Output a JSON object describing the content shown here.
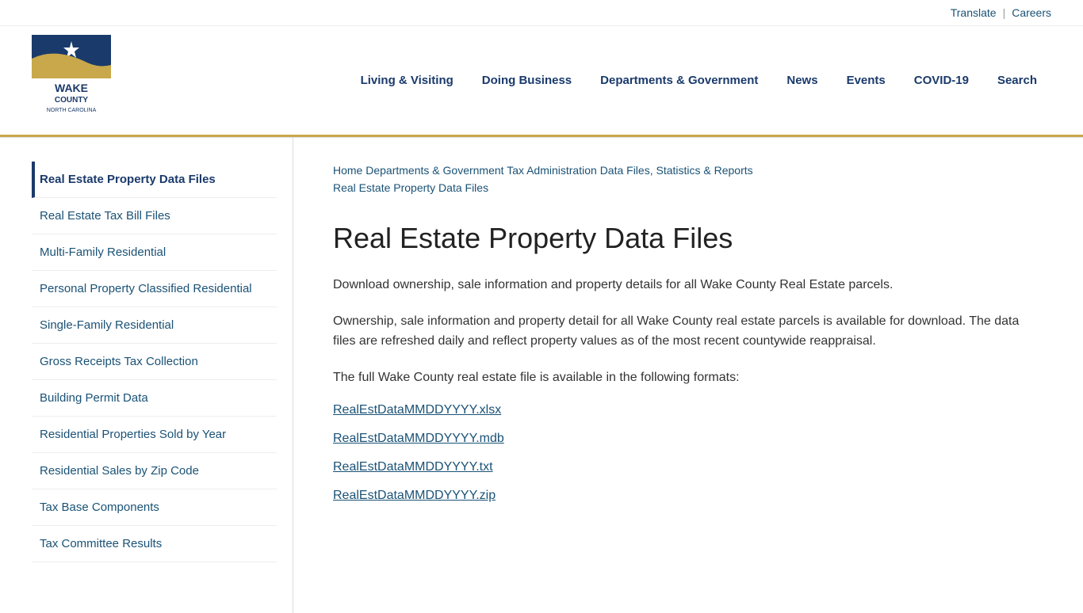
{
  "topbar": {
    "translate_label": "Translate",
    "separator": "|",
    "careers_label": "Careers"
  },
  "header": {
    "logo_alt": "Wake County North Carolina",
    "nav_items": [
      {
        "label": "Living & Visiting",
        "id": "living-visiting"
      },
      {
        "label": "Doing Business",
        "id": "doing-business"
      },
      {
        "label": "Departments & Government",
        "id": "departments-government"
      },
      {
        "label": "News",
        "id": "news"
      },
      {
        "label": "Events",
        "id": "events"
      },
      {
        "label": "COVID-19",
        "id": "covid-19"
      },
      {
        "label": "Search",
        "id": "search"
      }
    ]
  },
  "sidebar": {
    "items": [
      {
        "label": "Real Estate Property Data Files",
        "active": true,
        "id": "real-estate-data-files"
      },
      {
        "label": "Real Estate Tax Bill Files",
        "active": false,
        "id": "real-estate-tax-bill"
      },
      {
        "label": "Multi-Family Residential",
        "active": false,
        "id": "multi-family-residential"
      },
      {
        "label": "Personal Property Classified Residential",
        "active": false,
        "id": "personal-property-classified"
      },
      {
        "label": "Single-Family Residential",
        "active": false,
        "id": "single-family-residential"
      },
      {
        "label": "Gross Receipts Tax Collection",
        "active": false,
        "id": "gross-receipts-tax"
      },
      {
        "label": "Building Permit Data",
        "active": false,
        "id": "building-permit-data"
      },
      {
        "label": "Residential Properties Sold by Year",
        "active": false,
        "id": "residential-properties-sold"
      },
      {
        "label": "Residential Sales by Zip Code",
        "active": false,
        "id": "residential-sales-zip"
      },
      {
        "label": "Tax Base Components",
        "active": false,
        "id": "tax-base-components"
      },
      {
        "label": "Tax Committee Results",
        "active": false,
        "id": "tax-committee-results"
      }
    ]
  },
  "breadcrumb": {
    "items": [
      {
        "label": "Home",
        "href": "#"
      },
      {
        "label": "Departments & Government",
        "href": "#"
      },
      {
        "label": "Tax Administration",
        "href": "#"
      },
      {
        "label": "Data Files, Statistics & Reports",
        "href": "#"
      },
      {
        "label": "Real Estate Property Data Files",
        "href": "#"
      }
    ]
  },
  "main": {
    "page_title": "Real Estate Property Data Files",
    "paragraph1": "Download ownership, sale information and property details for all Wake County Real Estate parcels.",
    "paragraph2": "Ownership, sale information and property detail for all Wake County real estate parcels is available for download. The data files are refreshed daily and reflect property values as of the most recent countywide reappraisal.",
    "paragraph3": "The full Wake County real estate file is available in the following formats:",
    "file_links": [
      {
        "label": "RealEstDataMMDDYYYY.xlsx",
        "href": "#"
      },
      {
        "label": "RealEstDataMMDDYYYY.mdb",
        "href": "#"
      },
      {
        "label": "RealEstDataMMDDYYYY.txt",
        "href": "#"
      },
      {
        "label": "RealEstDataMMDDYYYY.zip",
        "href": "#"
      }
    ]
  }
}
